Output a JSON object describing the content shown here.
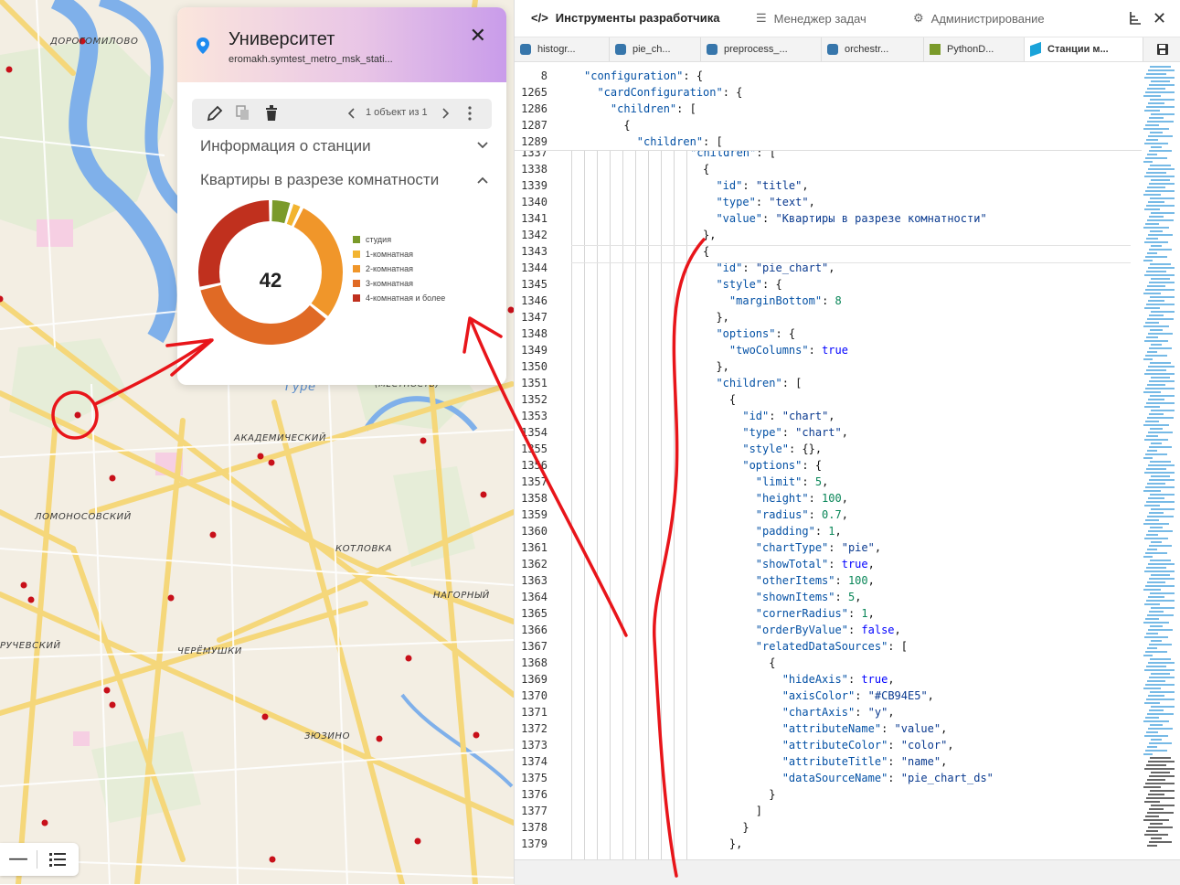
{
  "map": {
    "districts": [
      "ДОРОГОМИЛОВО",
      "АКАДЕМИЧЕСКИЙ",
      "ЛОМОНОСОВСКИЙ",
      "КОТЛОВКА",
      "НАГОРНЫЙ",
      "РУЧЕВСКИЙ",
      "ЧЕРЁМУШКИ",
      "ЗЮЗИНО",
      "(МЕСТНОСТЬ)",
      "Гуре"
    ],
    "zoom_out_label": "—"
  },
  "card": {
    "title": "Университет",
    "subtitle": "eromakh.symtest_metro_msk_stati...",
    "close": "✕",
    "counter": "1 объект из 1",
    "sections": {
      "info": "Информация о станции",
      "rooms": "Квартиры в разрезе комнатности"
    },
    "total": "42"
  },
  "chart_data": {
    "type": "pie",
    "total": 42,
    "categories": [
      "студия",
      "1-комнатная",
      "2-комнатная",
      "3-комнатная",
      "4-комнатная и более"
    ],
    "values": [
      2,
      1,
      12,
      15,
      12
    ],
    "colors": [
      "#7a9a2a",
      "#f2b430",
      "#f0962a",
      "#e06a25",
      "#c0301e"
    ]
  },
  "ide": {
    "tabs": [
      "Инструменты разработчика",
      "Менеджер задач",
      "Администрирование"
    ],
    "file_tabs": [
      "histogr...",
      "pie_ch...",
      "preprocess_...",
      "orchestr...",
      "PythonD...",
      "Станции м..."
    ],
    "sticky_lines": [
      {
        "no": "8",
        "text": "\"configuration\": {"
      },
      {
        "no": "1265",
        "text": "  \"cardConfiguration\": {"
      },
      {
        "no": "1286",
        "text": "    \"children\": ["
      },
      {
        "no": "1287",
        "text": "      {"
      },
      {
        "no": "1289",
        "text": "        \"children\": ["
      }
    ],
    "lines": [
      {
        "no": "1337",
        "text": "\"children\": ["
      },
      {
        "no": "1338",
        "text": "{"
      },
      {
        "no": "1339",
        "text": "  \"id\": \"title\","
      },
      {
        "no": "1340",
        "text": "  \"type\": \"text\","
      },
      {
        "no": "1341",
        "text": "  \"value\": \"Квартиры в разрезе комнатности\""
      },
      {
        "no": "1342",
        "text": "},"
      },
      {
        "no": "1343",
        "text": "{"
      },
      {
        "no": "1344",
        "text": "  \"id\": \"pie_chart\","
      },
      {
        "no": "1345",
        "text": "  \"style\": {"
      },
      {
        "no": "1346",
        "text": "    \"marginBottom\": 8"
      },
      {
        "no": "1347",
        "text": "  },"
      },
      {
        "no": "1348",
        "text": "  \"options\": {"
      },
      {
        "no": "1349",
        "text": "    \"twoColumns\": true"
      },
      {
        "no": "1350",
        "text": "  },"
      },
      {
        "no": "1351",
        "text": "  \"children\": ["
      },
      {
        "no": "1352",
        "text": "    {"
      },
      {
        "no": "1353",
        "text": "      \"id\": \"chart\","
      },
      {
        "no": "1354",
        "text": "      \"type\": \"chart\","
      },
      {
        "no": "1355",
        "text": "      \"style\": {},"
      },
      {
        "no": "1356",
        "text": "      \"options\": {"
      },
      {
        "no": "1357",
        "text": "        \"limit\": 5,"
      },
      {
        "no": "1358",
        "text": "        \"height\": 100,"
      },
      {
        "no": "1359",
        "text": "        \"radius\": 0.7,"
      },
      {
        "no": "1360",
        "text": "        \"padding\": 1,"
      },
      {
        "no": "1361",
        "text": "        \"chartType\": \"pie\","
      },
      {
        "no": "1362",
        "text": "        \"showTotal\": true,"
      },
      {
        "no": "1363",
        "text": "        \"otherItems\": 100,"
      },
      {
        "no": "1364",
        "text": "        \"shownItems\": 5,"
      },
      {
        "no": "1365",
        "text": "        \"cornerRadius\": 1,"
      },
      {
        "no": "1366",
        "text": "        \"orderByValue\": false,"
      },
      {
        "no": "1367",
        "text": "        \"relatedDataSources\": ["
      },
      {
        "no": "1368",
        "text": "          {"
      },
      {
        "no": "1369",
        "text": "            \"hideAxis\": true,"
      },
      {
        "no": "1370",
        "text": "            \"axisColor\": \"#CB94E5\","
      },
      {
        "no": "1371",
        "text": "            \"chartAxis\": \"y\","
      },
      {
        "no": "1372",
        "text": "            \"attributeName\": \"value\","
      },
      {
        "no": "1373",
        "text": "            \"attributeColor\": \"color\","
      },
      {
        "no": "1374",
        "text": "            \"attributeTitle\": \"name\","
      },
      {
        "no": "1375",
        "text": "            \"dataSourceName\": \"pie_chart_ds\""
      },
      {
        "no": "1376",
        "text": "          }"
      },
      {
        "no": "1377",
        "text": "        ]"
      },
      {
        "no": "1378",
        "text": "      }"
      },
      {
        "no": "1379",
        "text": "    },"
      }
    ]
  },
  "colors": {
    "metro_dot": "#c8101a",
    "annotation": "#e8151a",
    "pin": "#1e8bf0"
  }
}
